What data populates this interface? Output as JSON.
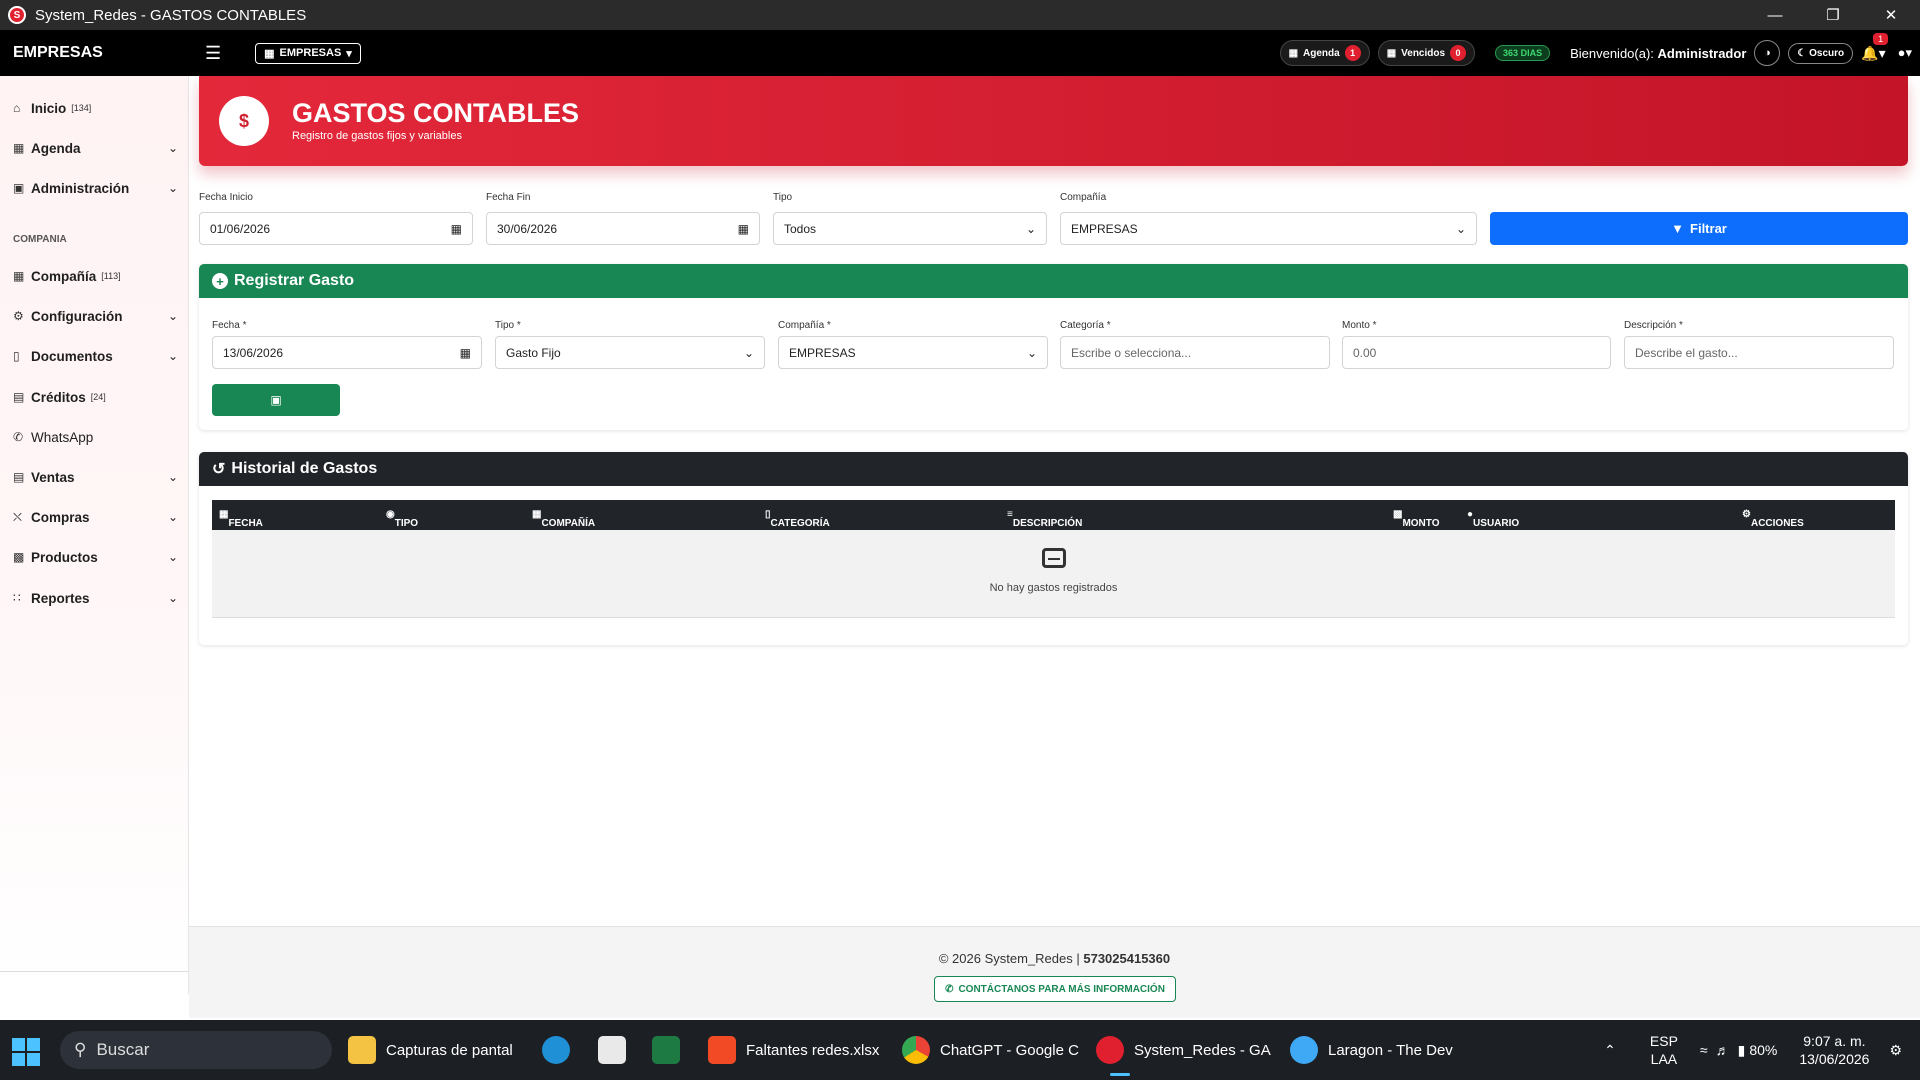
{
  "window": {
    "title": "System_Redes - GASTOS CONTABLES"
  },
  "navbar": {
    "brand": "EMPRESAS",
    "company_selector": "EMPRESAS",
    "agenda_label": "Agenda",
    "agenda_count": "1",
    "vencidos_label": "Vencidos",
    "vencidos_count": "0",
    "days_badge": "363 DIAS",
    "welcome_prefix": "Bienvenido(a):",
    "welcome_user": "Administrador",
    "theme_label": "Oscuro",
    "notif_count": "1"
  },
  "sidebar": {
    "items": [
      {
        "label": "Inicio",
        "badge": "[134]",
        "icon": "home-icon"
      },
      {
        "label": "Agenda",
        "icon": "calendar-icon"
      },
      {
        "label": "Administración",
        "icon": "id-card-icon"
      }
    ],
    "section": "COMPANIA",
    "items2": [
      {
        "label": "Compañía",
        "badge": "[113]",
        "icon": "building-icon"
      },
      {
        "label": "Configuración",
        "icon": "gears-icon"
      },
      {
        "label": "Documentos",
        "icon": "folder-icon"
      },
      {
        "label": "Créditos",
        "badge": "[24]",
        "icon": "credit-card-icon"
      },
      {
        "label": "WhatsApp",
        "icon": "whatsapp-icon"
      },
      {
        "label": "Ventas",
        "icon": "cash-icon"
      },
      {
        "label": "Compras",
        "icon": "cart-icon"
      },
      {
        "label": "Productos",
        "icon": "boxes-icon"
      },
      {
        "label": "Reportes",
        "icon": "chart-icon"
      }
    ]
  },
  "header": {
    "title": "GASTOS CONTABLES",
    "subtitle": "Registro de gastos fijos y variables"
  },
  "filters": {
    "start_label": "Fecha Inicio",
    "start_value": "01/06/2026",
    "end_label": "Fecha Fin",
    "end_value": "30/06/2026",
    "type_label": "Tipo",
    "type_value": "Todos",
    "company_label": "Compañía",
    "company_value": "EMPRESAS",
    "filter_button": "Filtrar"
  },
  "register": {
    "title": "Registrar Gasto",
    "date_label": "Fecha *",
    "date_value": "13/06/2026",
    "type_label": "Tipo *",
    "type_value": "Gasto Fijo",
    "company_label": "Compañía *",
    "company_value": "EMPRESAS",
    "category_label": "Categoría *",
    "category_placeholder": "Escribe o selecciona...",
    "amount_label": "Monto *",
    "amount_placeholder": "0.00",
    "desc_label": "Descripción *",
    "desc_placeholder": "Describe el gasto..."
  },
  "history": {
    "title": "Historial de Gastos",
    "columns": [
      "FECHA",
      "TIPO",
      "COMPAÑÍA",
      "CATEGORÍA",
      "DESCRIPCIÓN",
      "MONTO",
      "USUARIO",
      "ACCIONES"
    ],
    "empty_text": "No hay gastos registrados"
  },
  "footer": {
    "copyright": "© 2026 System_Redes |",
    "phone": "573025415360",
    "contact_button": "CONTÁCTANOS PARA MÁS INFORMACIÓN"
  },
  "taskbar": {
    "search": "Buscar",
    "apps": [
      {
        "label": "Capturas de pantal"
      },
      {
        "label": "Faltantes redes.xlsx"
      },
      {
        "label": "ChatGPT - Google C"
      },
      {
        "label": "System_Redes - GA"
      },
      {
        "label": "Laragon - The Dev"
      }
    ],
    "lang1": "ESP",
    "lang2": "LAA",
    "battery": "80%",
    "time": "9:07 a. m.",
    "date": "13/06/2026"
  }
}
